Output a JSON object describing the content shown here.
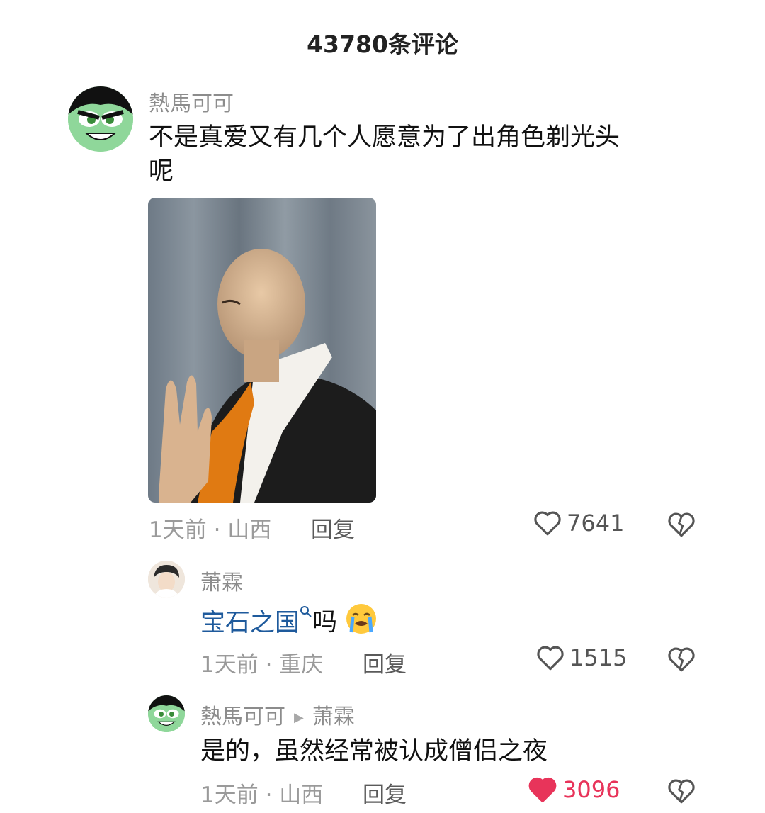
{
  "header": {
    "title": "43780条评论"
  },
  "comments": [
    {
      "username": "熱馬可可",
      "text_line1": "不是真爱又有几个人愿意为了出角色剃光头",
      "text_line2": "呢",
      "meta": "1天前 · 山西",
      "reply_label": "回复",
      "likes": "7641",
      "liked": false
    },
    {
      "username": "萧霖",
      "topic": "宝石之国",
      "text_after": "吗",
      "emoji": "loudly-crying-face",
      "meta": "1天前 · 重庆",
      "reply_label": "回复",
      "likes": "1515",
      "liked": false
    },
    {
      "username": "熱馬可可",
      "reply_to": "萧霖",
      "text": "是的，虽然经常被认成僧侣之夜",
      "meta": "1天前 · 山西",
      "reply_label": "回复",
      "likes": "3096",
      "liked": true
    }
  ],
  "colors": {
    "liked_heart": "#e8345a",
    "topic_link": "#1e5a9c"
  },
  "icons": [
    "heart-outline-icon",
    "heart-filled-icon",
    "broken-heart-icon",
    "search-icon",
    "reply-arrow-icon"
  ]
}
